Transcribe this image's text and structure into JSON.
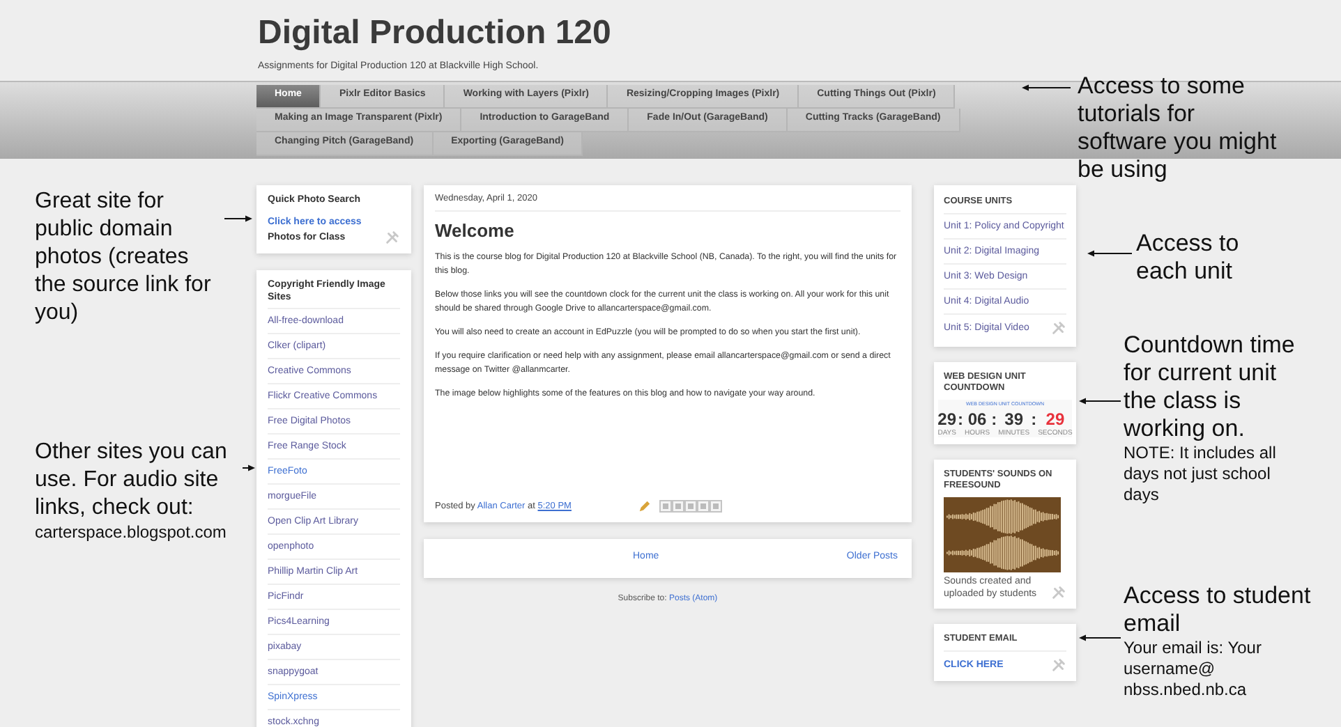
{
  "blog": {
    "title": "Digital Production 120",
    "description": "Assignments for Digital Production 120 at Blackville High School."
  },
  "nav_tabs": [
    {
      "label": "Home",
      "selected": true
    },
    {
      "label": "Pixlr Editor Basics",
      "selected": false
    },
    {
      "label": "Working with Layers (Pixlr)",
      "selected": false
    },
    {
      "label": "Resizing/Cropping Images (Pixlr)",
      "selected": false
    },
    {
      "label": "Cutting Things Out (Pixlr)",
      "selected": false
    },
    {
      "label": "Making an Image Transparent (Pixlr)",
      "selected": false
    },
    {
      "label": "Introduction to GarageBand",
      "selected": false
    },
    {
      "label": "Fade In/Out (GarageBand)",
      "selected": false
    },
    {
      "label": "Cutting Tracks (GarageBand)",
      "selected": false
    },
    {
      "label": "Changing Pitch (GarageBand)",
      "selected": false
    },
    {
      "label": "Exporting (GarageBand)",
      "selected": false
    }
  ],
  "left_sidebar": {
    "quick_photo": {
      "title": "Quick Photo Search",
      "link": "Click here to access",
      "caption": "Photos for Class"
    },
    "image_sites": {
      "title": "Copyright Friendly Image Sites",
      "links": [
        {
          "label": "All-free-download",
          "visited": true
        },
        {
          "label": "Clker (clipart)",
          "visited": true
        },
        {
          "label": "Creative Commons",
          "visited": true
        },
        {
          "label": "Flickr Creative Commons",
          "visited": true
        },
        {
          "label": "Free Digital Photos",
          "visited": true
        },
        {
          "label": "Free Range Stock",
          "visited": true
        },
        {
          "label": "FreeFoto",
          "visited": false
        },
        {
          "label": "morgueFile",
          "visited": true
        },
        {
          "label": "Open Clip Art Library",
          "visited": true
        },
        {
          "label": "openphoto",
          "visited": true
        },
        {
          "label": "Phillip Martin Clip Art",
          "visited": true
        },
        {
          "label": "PicFindr",
          "visited": true
        },
        {
          "label": "Pics4Learning",
          "visited": true
        },
        {
          "label": "pixabay",
          "visited": true
        },
        {
          "label": "snappygoat",
          "visited": true
        },
        {
          "label": "SpinXpress",
          "visited": false
        },
        {
          "label": "stock.xchng",
          "visited": true
        }
      ]
    }
  },
  "post": {
    "date": "Wednesday, April 1, 2020",
    "title": "Welcome",
    "paragraphs": [
      "This is the course blog for Digital Production 120 at Blackville School (NB, Canada). To the right, you will find the units for this blog.",
      "Below those links you will see the countdown clock for the current unit the class is working on. All your work for this unit should be shared through Google Drive to allancarterspace@gmail.com.",
      "You will also need to create an account in EdPuzzle (you will be prompted to do so when you start the first unit).",
      "If you require clarification or need help with any assignment, please email allancarterspace@gmail.com or send a direct message on Twitter @allanmcarter.",
      "The image below highlights some of the features on this blog and how to navigate your way around."
    ],
    "footer": {
      "prefix": "Posted by",
      "author": "Allan Carter",
      "at": "at",
      "time": "5:20 PM"
    }
  },
  "pager": {
    "home": "Home",
    "older": "Older Posts"
  },
  "subscribe": {
    "prefix": "Subscribe to:",
    "link": "Posts (Atom)"
  },
  "right_sidebar": {
    "course_units": {
      "title": "COURSE UNITS",
      "links": [
        "Unit 1: Policy and Copyright",
        "Unit 2: Digital Imaging",
        "Unit 3: Web Design",
        "Unit 4: Digital Audio",
        "Unit 5: Digital Video"
      ]
    },
    "countdown": {
      "title": "WEB DESIGN UNIT COUNTDOWN",
      "caption": "WEB DESIGN UNIT COUNTDOWN",
      "separator": ":",
      "segments": [
        {
          "value": "29",
          "unit": "DAYS",
          "color": "#333333"
        },
        {
          "value": "06",
          "unit": "HOURS",
          "color": "#333333"
        },
        {
          "value": "39",
          "unit": "MINUTES",
          "color": "#333333"
        },
        {
          "value": "29",
          "unit": "SECONDS",
          "color": "#e8323c"
        }
      ]
    },
    "sounds": {
      "title": "STUDENTS' SOUNDS ON FREESOUND",
      "caption": "Sounds created and uploaded by students"
    },
    "email": {
      "title": "STUDENT EMAIL",
      "link": "CLICK HERE"
    }
  },
  "annotations": [
    {
      "text": "Access to some tutorials for software you might be using"
    },
    {
      "text": "Great site for public domain photos (creates the source link for you)"
    },
    {
      "text": "Access to each unit"
    },
    {
      "text": "Countdown time for current unit the class is working on.",
      "note": "NOTE: It includes all days not just school days"
    },
    {
      "text": "Other sites you can use. For audio site links, check out:",
      "note": "carterspace.blogspot.com"
    },
    {
      "text": "Access to student email",
      "note": "Your email is: Your username@ nbss.nbed.nb.ca"
    }
  ]
}
